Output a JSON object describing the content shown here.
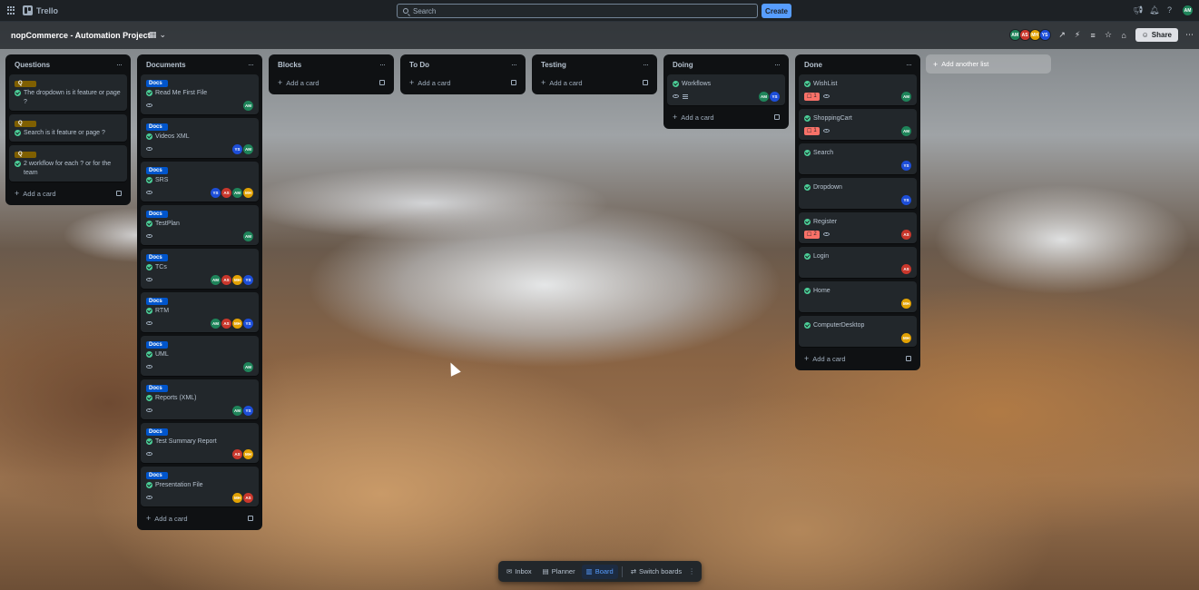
{
  "app": {
    "name": "Trello"
  },
  "search": {
    "placeholder": "Search"
  },
  "topnav": {
    "create_label": "Create",
    "user_initials": "AM"
  },
  "board": {
    "title": "nopCommerce - Automation Project",
    "share_label": "Share"
  },
  "members": [
    "AM",
    "AS",
    "MH",
    "YS"
  ],
  "colors": {
    "AM": "#1f845a",
    "AS": "#c9372c",
    "MH": "#e2a203",
    "YS": "#1d4ed8",
    "docs_label": "#0055cc",
    "q_label": "#7f5f01",
    "issue": "#f87168"
  },
  "lists": [
    {
      "title": "Questions",
      "add_label": "Add a card",
      "cards": [
        {
          "label": "Q",
          "title": "The dropdown is it feature or page ?"
        },
        {
          "label": "Q",
          "title": "Search is it feature or page ?"
        },
        {
          "label": "Q",
          "title": "2 workflow for each ? or for the team"
        }
      ]
    },
    {
      "title": "Documents",
      "add_label": "Add a card",
      "cards": [
        {
          "label": "Docs",
          "title": "Read Me First File",
          "members": [
            "AM"
          ]
        },
        {
          "label": "Docs",
          "title": "Videos XML",
          "members": [
            "YS",
            "AM"
          ]
        },
        {
          "label": "Docs",
          "title": "SRS",
          "members": [
            "YS",
            "AS",
            "AM",
            "MH"
          ]
        },
        {
          "label": "Docs",
          "title": "TestPlan",
          "members": [
            "AM"
          ]
        },
        {
          "label": "Docs",
          "title": "TCs",
          "members": [
            "AM",
            "AS",
            "MH",
            "YS"
          ]
        },
        {
          "label": "Docs",
          "title": "RTM",
          "members": [
            "AM",
            "AS",
            "MH",
            "YS"
          ]
        },
        {
          "label": "Docs",
          "title": "UML",
          "members": [
            "AM"
          ]
        },
        {
          "label": "Docs",
          "title": "Reports (XML)",
          "members": [
            "AM",
            "YS"
          ]
        },
        {
          "label": "Docs",
          "title": "Test Summary Report",
          "members": [
            "AS",
            "MH"
          ]
        },
        {
          "label": "Docs",
          "title": "Presentation File",
          "members": [
            "MH",
            "AS"
          ]
        }
      ]
    },
    {
      "title": "Blocks",
      "add_label": "Add a card",
      "cards": []
    },
    {
      "title": "To Do",
      "add_label": "Add a card",
      "cards": []
    },
    {
      "title": "Testing",
      "add_label": "Add a card",
      "cards": []
    },
    {
      "title": "Doing",
      "add_label": "Add a card",
      "cards": [
        {
          "title": "Workflows",
          "members": [
            "AM",
            "YS"
          ]
        }
      ]
    },
    {
      "title": "Done",
      "add_label": "Add a card",
      "cards": [
        {
          "title": "WishList",
          "issue": "1",
          "members": [
            "AM"
          ]
        },
        {
          "title": "ShoppingCart",
          "issue": "1",
          "members": [
            "AM"
          ]
        },
        {
          "title": "Search",
          "members": [
            "YS"
          ]
        },
        {
          "title": "Dropdown",
          "members": [
            "YS"
          ]
        },
        {
          "title": "Register",
          "issue": "2",
          "members": [
            "AS"
          ]
        },
        {
          "title": "Login",
          "members": [
            "AS"
          ]
        },
        {
          "title": "Home",
          "members": [
            "MH"
          ]
        },
        {
          "title": "ComputerDesktop",
          "members": [
            "MH"
          ]
        }
      ]
    }
  ],
  "add_list_label": "Add another list",
  "bottom": {
    "inbox": "Inbox",
    "planner": "Planner",
    "board": "Board",
    "switch": "Switch boards"
  }
}
